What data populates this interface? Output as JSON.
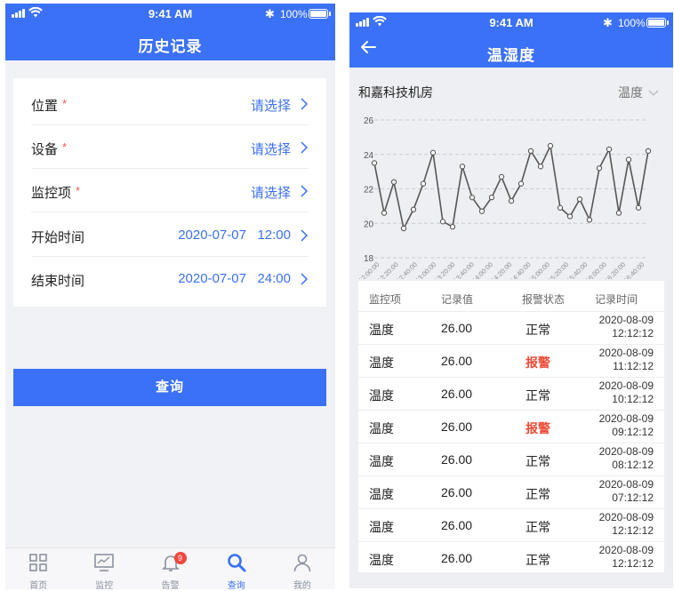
{
  "left": {
    "status": {
      "time": "9:41 AM",
      "battery": "100%"
    },
    "header": {
      "title": "历史记录"
    },
    "form": {
      "rows": [
        {
          "label": "位置",
          "required": "*",
          "value": "请选择"
        },
        {
          "label": "设备",
          "required": "*",
          "value": "请选择"
        },
        {
          "label": "监控项",
          "required": "*",
          "value": "请选择"
        },
        {
          "label": "开始时间",
          "required": "",
          "value": "2020-07-07   12:00"
        },
        {
          "label": "结束时间",
          "required": "",
          "value": "2020-07-07   24:00"
        }
      ]
    },
    "query_label": "查询",
    "tabbar": {
      "tabs": [
        {
          "label": "首页",
          "icon": "grid-icon"
        },
        {
          "label": "监控",
          "icon": "monitor-chart-icon"
        },
        {
          "label": "告警",
          "icon": "bell-icon",
          "badge": "9"
        },
        {
          "label": "查询",
          "icon": "search-icon",
          "active": true
        },
        {
          "label": "我的",
          "icon": "user-icon"
        }
      ]
    }
  },
  "right": {
    "status": {
      "time": "9:41 AM",
      "battery": "100%"
    },
    "header": {
      "title": "温湿度"
    },
    "room": "和嘉科技机房",
    "metric": "温度",
    "chart_data": {
      "type": "line",
      "title": "",
      "xlabel": "",
      "ylabel": "",
      "ylim": [
        18,
        26
      ],
      "yticks": [
        18,
        20,
        22,
        24,
        26
      ],
      "grid": true,
      "x_tick_labels": [
        "12:00:00",
        "12:20:00",
        "12:40:00",
        "13:00:00",
        "13:20:00",
        "13:40:00",
        "14:00:00",
        "14:20:00",
        "14:40:00",
        "15:00:00",
        "15:20:00",
        "15:40:00",
        "16:00:00",
        "16:20:00",
        "16:40:00"
      ],
      "values": [
        23.5,
        20.6,
        22.4,
        19.7,
        20.8,
        22.3,
        24.1,
        20.1,
        19.8,
        23.3,
        21.5,
        20.7,
        21.5,
        22.7,
        21.3,
        22.3,
        24.2,
        23.3,
        24.5,
        20.9,
        20.4,
        21.4,
        20.2,
        23.2,
        24.3,
        20.6,
        23.7,
        20.9,
        24.2
      ]
    },
    "table": {
      "headers": [
        "监控项",
        "记录值",
        "报警状态",
        "记录时间"
      ],
      "rows": [
        {
          "item": "温度",
          "value": "26.00",
          "status": "正常",
          "alarm": false,
          "date": "2020-08-09",
          "time": "12:12:12"
        },
        {
          "item": "温度",
          "value": "26.00",
          "status": "报警",
          "alarm": true,
          "date": "2020-08-09",
          "time": "11:12:12"
        },
        {
          "item": "温度",
          "value": "26.00",
          "status": "正常",
          "alarm": false,
          "date": "2020-08-09",
          "time": "10:12:12"
        },
        {
          "item": "温度",
          "value": "26.00",
          "status": "报警",
          "alarm": true,
          "date": "2020-08-09",
          "time": "09:12:12"
        },
        {
          "item": "温度",
          "value": "26.00",
          "status": "正常",
          "alarm": false,
          "date": "2020-08-09",
          "time": "08:12:12"
        },
        {
          "item": "温度",
          "value": "26.00",
          "status": "正常",
          "alarm": false,
          "date": "2020-08-09",
          "time": "07:12:12"
        },
        {
          "item": "温度",
          "value": "26.00",
          "status": "正常",
          "alarm": false,
          "date": "2020-08-09",
          "time": "12:12:12"
        },
        {
          "item": "温度",
          "value": "26.00",
          "status": "正常",
          "alarm": false,
          "date": "2020-08-09",
          "time": "12:12:12"
        }
      ]
    }
  },
  "colors": {
    "primary": "#3b71f6",
    "alarm": "#ef4a36",
    "required": "#f1574a"
  }
}
